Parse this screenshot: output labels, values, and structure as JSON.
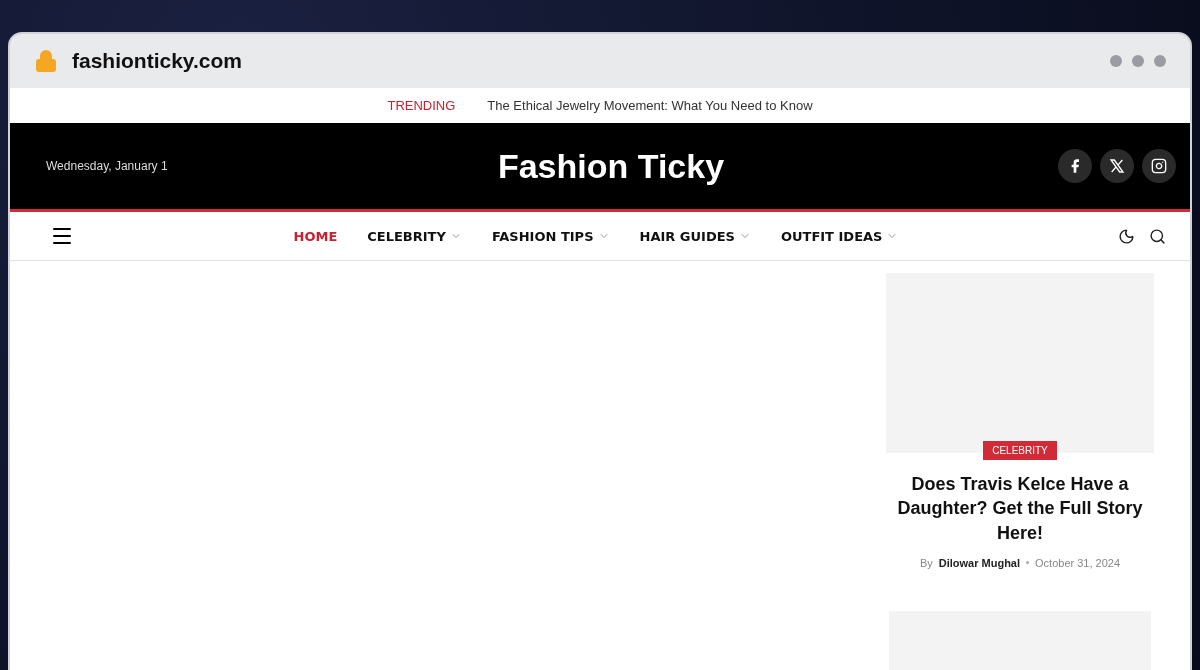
{
  "browser": {
    "url": "fashionticky.com"
  },
  "trending": {
    "label": "TRENDING",
    "headline": "The Ethical Jewelry Movement: What You Need to Know"
  },
  "header": {
    "date": "Wednesday, January 1",
    "site_title": "Fashion Ticky",
    "social": [
      {
        "kind": "facebook"
      },
      {
        "kind": "x"
      },
      {
        "kind": "instagram"
      }
    ]
  },
  "nav": {
    "items": [
      {
        "label": "HOME",
        "selected": true,
        "has_dropdown": false
      },
      {
        "label": "CELEBRITY",
        "selected": false,
        "has_dropdown": true
      },
      {
        "label": "FASHION TIPS",
        "selected": false,
        "has_dropdown": true
      },
      {
        "label": "HAIR GUIDES",
        "selected": false,
        "has_dropdown": true
      },
      {
        "label": "OUTFIT IDEAS",
        "selected": false,
        "has_dropdown": true
      }
    ]
  },
  "sidebar": {
    "posts": [
      {
        "category": "CELEBRITY",
        "title": "Does Travis Kelce Have a Daughter? Get the Full Story Here!",
        "by": "By",
        "author": "Dilowar Mughal",
        "date": "October 31, 2024"
      }
    ]
  }
}
